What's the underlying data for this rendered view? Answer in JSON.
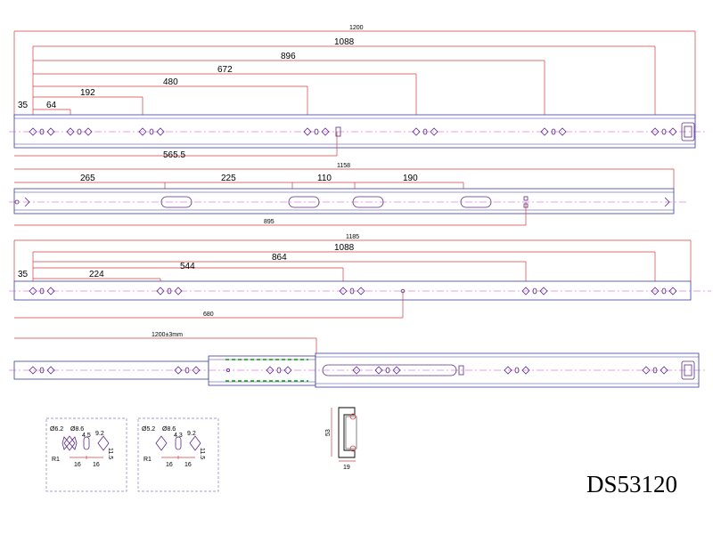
{
  "title": "DS53120",
  "view1": {
    "overall": "1200",
    "dims": [
      "1088",
      "896",
      "672",
      "480",
      "192",
      "64",
      "35"
    ],
    "bottom": "565.5"
  },
  "view2": {
    "overall": "1158",
    "dims": [
      "265",
      "225",
      "110",
      "190"
    ],
    "bottom": "895"
  },
  "view3": {
    "overall": "1185",
    "dims": [
      "1088",
      "864",
      "544",
      "224",
      "35"
    ],
    "bottom": "680"
  },
  "view4": {
    "overall": "1200±3mm"
  },
  "detail1": {
    "d1": "Ø6.2",
    "d2": "Ø8.6",
    "w": "4.5",
    "h1": "9.2",
    "h2": "11.5",
    "r": "R1",
    "p1": "16",
    "p2": "16"
  },
  "detail2": {
    "d1": "Ø5.2",
    "d2": "Ø8.6",
    "w": "4.3",
    "h1": "9.2",
    "h2": "11.5",
    "r": "R1",
    "p1": "16",
    "p2": "16"
  },
  "section": {
    "height": "53",
    "width": "19"
  }
}
